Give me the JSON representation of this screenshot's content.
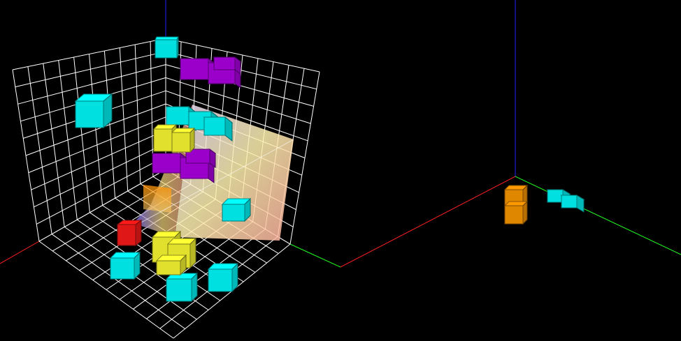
{
  "scene": {
    "background": "#000000",
    "grid_color": "#ffffff",
    "axis_colors": {
      "x": "#ff2020",
      "y": "#20ff20",
      "z": "#2020ff"
    },
    "block_colors": {
      "cyan": "#00ffff",
      "purple": "#b000e6",
      "yellow": "#ffff33",
      "red": "#ff1a1a",
      "orange": "#ff9900"
    },
    "main_view": {
      "grid_cells": 10,
      "blocks": [
        {
          "color": "cyan"
        },
        {
          "color": "cyan"
        },
        {
          "color": "cyan"
        },
        {
          "color": "cyan"
        },
        {
          "color": "cyan"
        },
        {
          "color": "cyan"
        },
        {
          "color": "cyan"
        },
        {
          "color": "purple"
        },
        {
          "color": "purple"
        },
        {
          "color": "yellow"
        },
        {
          "color": "yellow"
        },
        {
          "color": "red"
        }
      ]
    },
    "preview_view": {
      "blocks": [
        {
          "color": "orange",
          "units": 2
        },
        {
          "color": "cyan",
          "units": 2
        }
      ]
    }
  },
  "footer": {
    "text": ""
  }
}
